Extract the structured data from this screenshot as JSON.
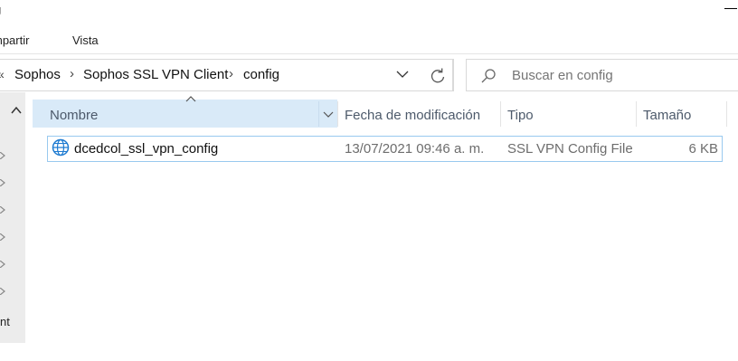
{
  "window": {
    "title": "g"
  },
  "ribbon": {
    "tabs": [
      {
        "label": "mpartir"
      },
      {
        "label": "Vista"
      }
    ]
  },
  "address": {
    "overflow": "«",
    "crumbs": [
      {
        "label": "Sophos"
      },
      {
        "label": "Sophos SSL VPN Client"
      },
      {
        "label": "config"
      }
    ],
    "separator": "›"
  },
  "search": {
    "placeholder": "Buscar en config"
  },
  "nav": {
    "partial_label": "nt"
  },
  "columns": [
    {
      "label": "Nombre"
    },
    {
      "label": "Fecha de modificación"
    },
    {
      "label": "Tipo"
    },
    {
      "label": "Tamaño"
    }
  ],
  "files": [
    {
      "name": "dcedcol_ssl_vpn_config",
      "modified": "13/07/2021 09:46 a. m.",
      "type": "SSL VPN Config File",
      "size": "6 KB",
      "icon": "globe-icon"
    }
  ],
  "colors": {
    "selection": "#d9eaf8",
    "row_border": "#99c9ef",
    "icon": "#1e7bd1"
  }
}
